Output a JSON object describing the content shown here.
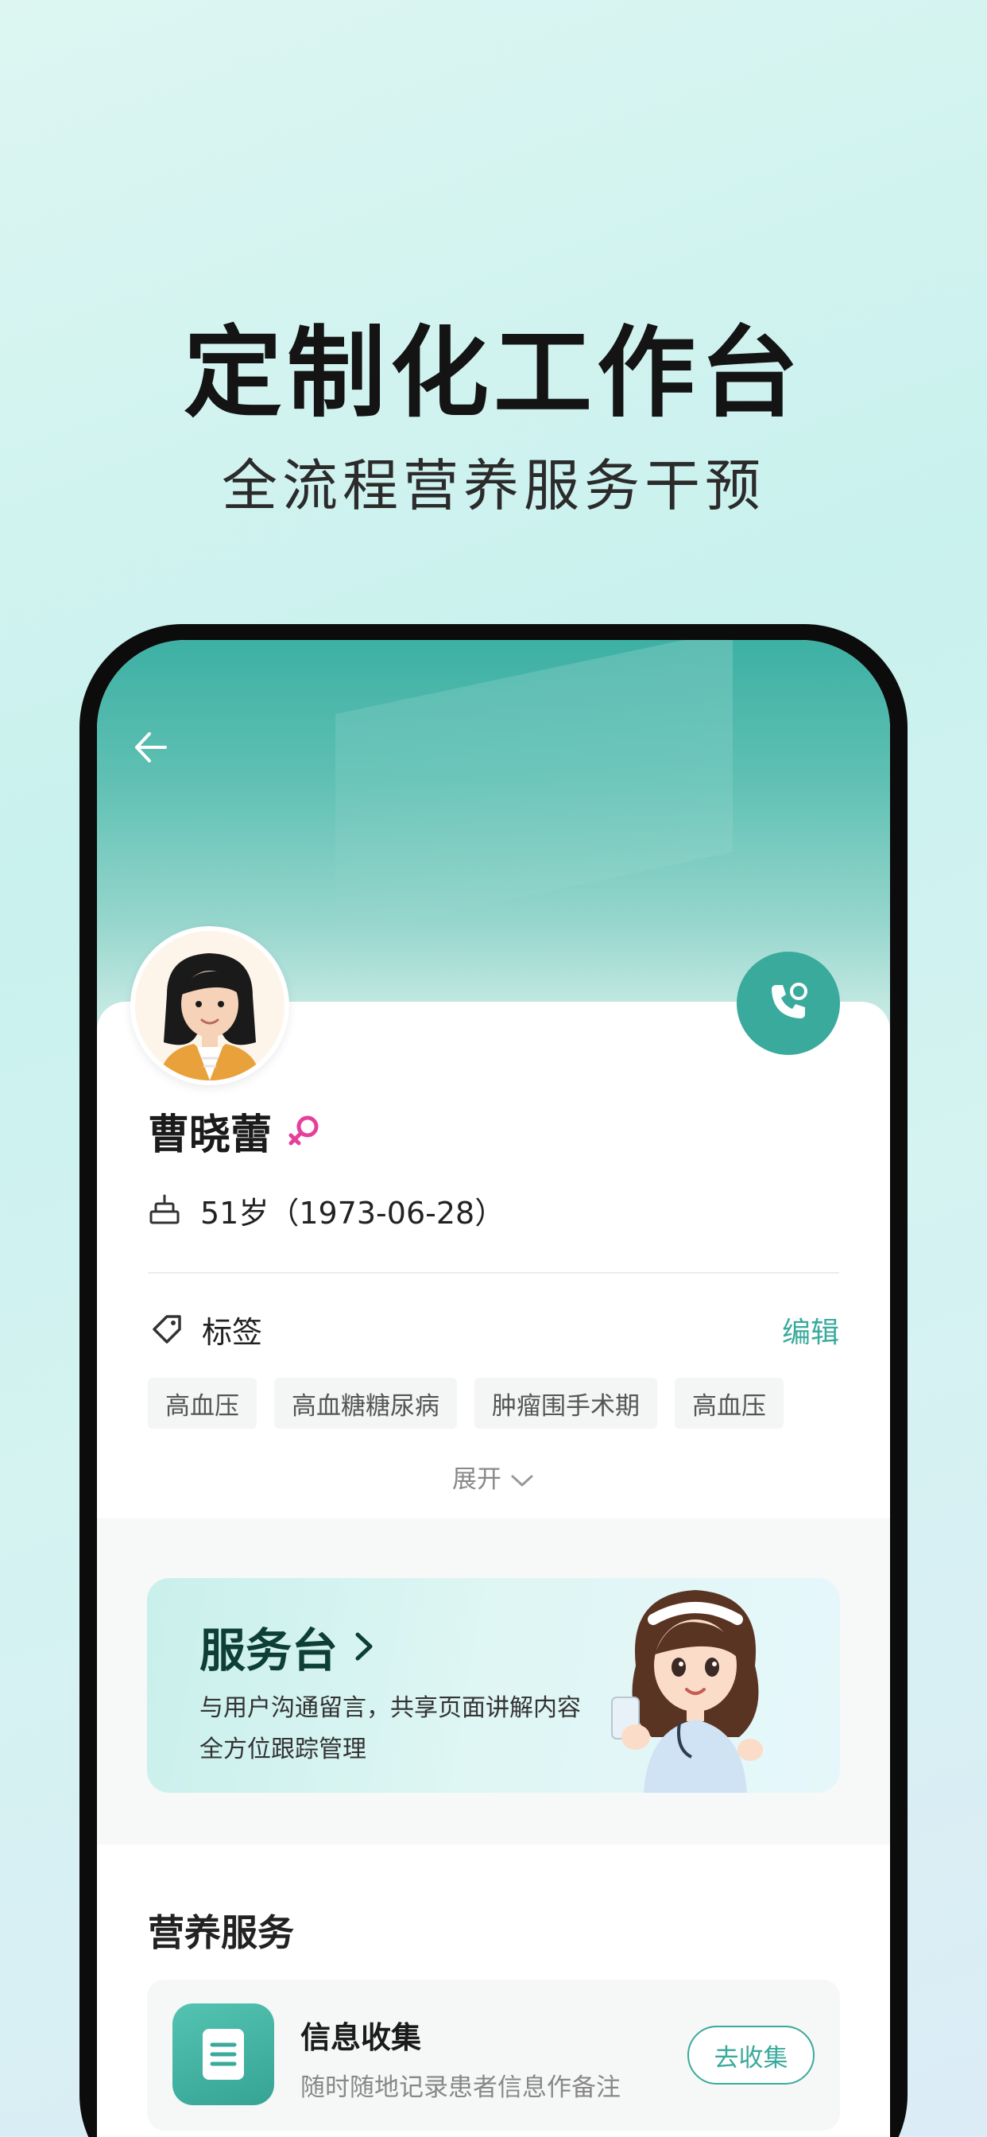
{
  "hero": {
    "title": "定制化工作台",
    "subtitle": "全流程营养服务干预"
  },
  "profile": {
    "name": "曹晓蕾",
    "gender_icon": "female-icon",
    "age_text": "51岁（1973-06-28）"
  },
  "tags": {
    "label": "标签",
    "edit": "编辑",
    "items": [
      "高血压",
      "高血糖糖尿病",
      "肿瘤围手术期",
      "高血压"
    ],
    "expand": "展开"
  },
  "service": {
    "title": "服务台",
    "desc_line1": "与用户沟通留言，共享页面讲解内容",
    "desc_line2": "全方位跟踪管理"
  },
  "nutrition": {
    "section_title": "营养服务",
    "info_title": "信息收集",
    "info_desc": "随时随地记录患者信息作备注",
    "collect_button": "去收集"
  },
  "colors": {
    "accent": "#3aaa9c",
    "gender": "#e5409b"
  }
}
